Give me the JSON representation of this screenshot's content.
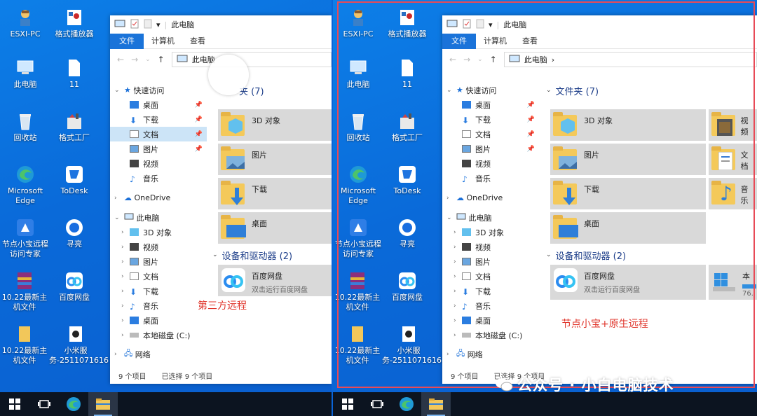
{
  "desktop_icons": [
    "ESXI-PC",
    "格式播放器",
    "此电脑",
    "11",
    "回收站",
    "格式工厂",
    "Microsoft Edge",
    "ToDesk",
    "节点小宝远程访问专家",
    "寻亮",
    "10.22最新主机文件",
    "百度网盘",
    "10.22最新主机文件",
    "小米服务-2511071616"
  ],
  "explorer": {
    "title": "此电脑",
    "ribbon": [
      "文件",
      "计算机",
      "查看"
    ],
    "address": "此电脑",
    "address_chevron": "›",
    "nav": {
      "quick_access": "快速访问",
      "quick_items": [
        "桌面",
        "下载",
        "文档",
        "图片",
        "视频",
        "音乐"
      ],
      "onedrive": "OneDrive",
      "this_pc": "此电脑",
      "pc_items": [
        "3D 对象",
        "视频",
        "图片",
        "文档",
        "下载",
        "音乐",
        "桌面",
        "本地磁盘 (C:)"
      ],
      "network": "网络"
    },
    "folders_header": "文件夹 (7)",
    "folders_header_left": "夹 (7)",
    "folders": [
      "3D 对象",
      "图片",
      "下载",
      "桌面"
    ],
    "folders_right_col": [
      "视频",
      "文档",
      "音乐"
    ],
    "devices_header": "设备和驱动器 (2)",
    "drive_name": "百度网盘",
    "drive_sub": "双击运行百度网盘",
    "local_disk_label": "本",
    "local_disk_size": "76.",
    "status_count": "9 个项目",
    "status_selected": "已选择 9 个项目"
  },
  "annotations": {
    "left": "第三方远程",
    "right": "节点小宝+原生远程"
  },
  "watermark": "公众号 · 小白电脑技术",
  "colors": {
    "accent": "#1a73d9",
    "highlight": "#e0352b",
    "frame": "#e84a57"
  }
}
